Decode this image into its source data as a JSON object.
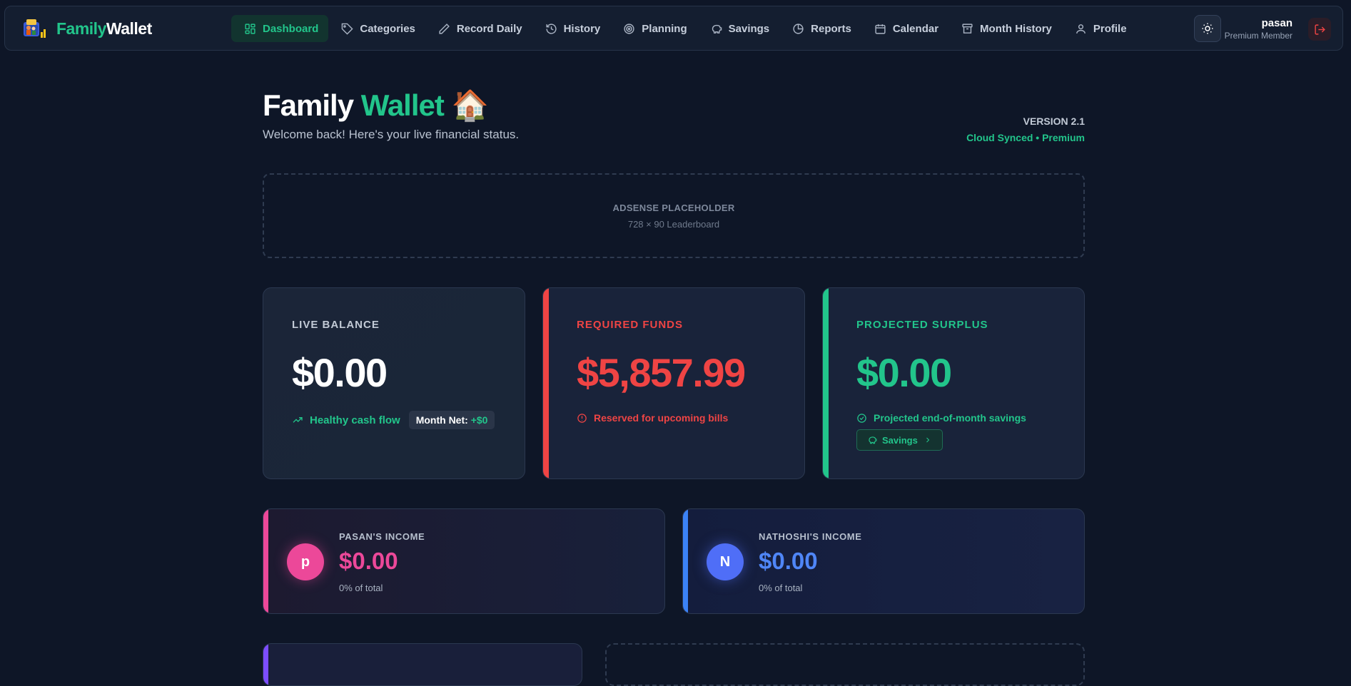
{
  "brand": {
    "name_part1": "Family",
    "name_part2": "Wallet"
  },
  "nav": [
    {
      "label": "Dashboard",
      "icon": "dashboard-icon"
    },
    {
      "label": "Categories",
      "icon": "tag-icon"
    },
    {
      "label": "Record Daily",
      "icon": "pencil-icon"
    },
    {
      "label": "History",
      "icon": "history-icon"
    },
    {
      "label": "Planning",
      "icon": "target-icon"
    },
    {
      "label": "Savings",
      "icon": "piggy-bank-icon"
    },
    {
      "label": "Reports",
      "icon": "pie-chart-icon"
    },
    {
      "label": "Calendar",
      "icon": "calendar-icon"
    },
    {
      "label": "Month History",
      "icon": "archive-icon"
    },
    {
      "label": "Profile",
      "icon": "user-icon"
    }
  ],
  "user": {
    "name": "pasan",
    "role": "Premium Member"
  },
  "header": {
    "title_part1": "Family",
    "title_part2": "Wallet",
    "title_emoji": "🏠",
    "subtitle": "Welcome back! Here's your live financial status.",
    "version": "VERSION 2.1",
    "sync_status": "Cloud Synced • Premium"
  },
  "adsense": {
    "title": "ADSENSE PLACEHOLDER",
    "size": "728 × 90 Leaderboard"
  },
  "cards": {
    "live_balance": {
      "label": "LIVE BALANCE",
      "value": "$0.00",
      "status": "Healthy cash flow",
      "month_net_label": "Month Net:",
      "month_net_value": "+$0"
    },
    "required_funds": {
      "label": "REQUIRED FUNDS",
      "value": "$5,857.99",
      "note": "Reserved for upcoming bills"
    },
    "projected_surplus": {
      "label": "PROJECTED SURPLUS",
      "value": "$0.00",
      "note": "Projected end-of-month savings",
      "button": "Savings"
    }
  },
  "income": [
    {
      "initial": "p",
      "label": "PASAN'S INCOME",
      "value": "$0.00",
      "share": "0% of total"
    },
    {
      "initial": "N",
      "label": "NATHOSHI'S INCOME",
      "value": "$0.00",
      "share": "0% of total"
    }
  ],
  "colors": {
    "accent_green": "#22c58b",
    "danger_red": "#ef4444",
    "pink": "#ec4899",
    "blue": "#3b82f6",
    "purple": "#7c4dff"
  }
}
